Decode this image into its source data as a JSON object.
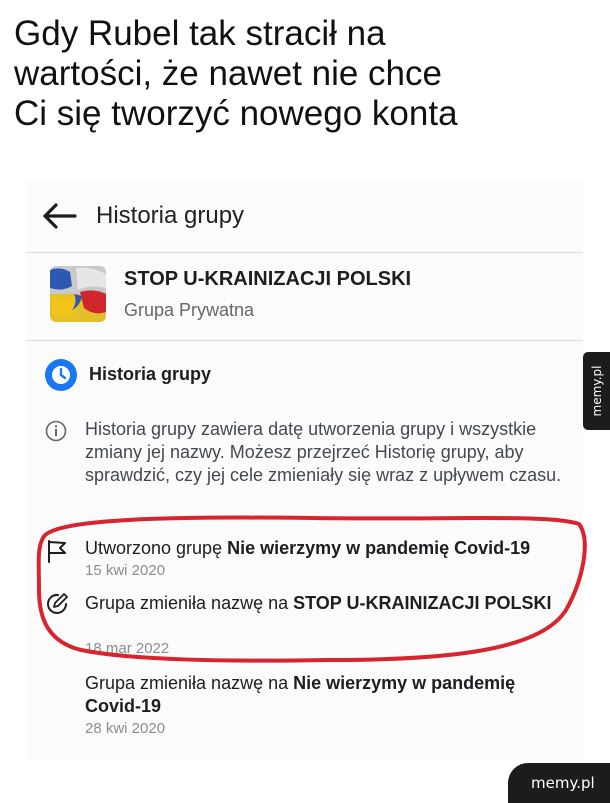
{
  "caption": {
    "line1": "Gdy Rubel tak stracił na",
    "line2": "wartości, że nawet nie chce",
    "line3": "Ci się tworzyć nowego konta"
  },
  "header": {
    "title": "Historia grupy",
    "back_icon": "arrow-left-icon"
  },
  "group": {
    "name": "STOP U-KRAINIZACJI POLSKI",
    "type": "Grupa Prywatna"
  },
  "section": {
    "title": "Historia grupy",
    "icon": "clock-icon",
    "accent": "#1877f2"
  },
  "info": {
    "icon": "info-icon",
    "text": "Historia grupy zawiera datę utworzenia grupy i wszystkie zmiany jej nazwy. Możesz przejrzeć Historię grupy, aby sprawdzić, czy jej cele zmieniały się wraz z upływem czasu."
  },
  "entries": [
    {
      "icon": "flag-icon",
      "prefix": "Utworzono grupę ",
      "bold": "Nie wierzymy w pandemię Covid-19",
      "date": "15 kwi 2020"
    },
    {
      "icon": "edit-icon",
      "prefix": "Grupa zmieniła nazwę na ",
      "bold": "STOP U-KRAINIZACJI POLSKI",
      "date": "18 mar 2022"
    },
    {
      "icon": "",
      "prefix": "Grupa zmieniła nazwę na ",
      "bold": "Nie wierzymy w pandemię Covid-19",
      "date": "28 kwi 2020"
    }
  ],
  "highlight_color": "#d8242f",
  "watermark": {
    "side": "memy.pl",
    "brand": "memy.pl"
  }
}
